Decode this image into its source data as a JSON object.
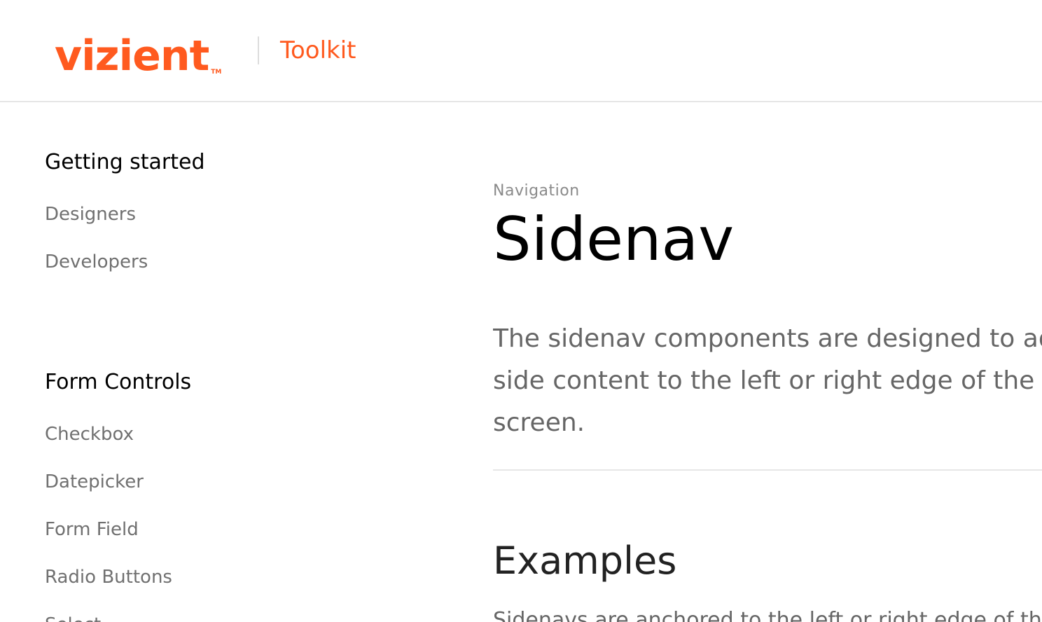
{
  "brand": {
    "logo_text": "vizient",
    "logo_tm": "TM",
    "product_label": "Toolkit",
    "accent_color": "#ff5a1f"
  },
  "sidebar": {
    "sections": [
      {
        "title": "Getting started",
        "items": [
          {
            "label": "Designers"
          },
          {
            "label": "Developers"
          }
        ]
      },
      {
        "title": "Form Controls",
        "items": [
          {
            "label": "Checkbox"
          },
          {
            "label": "Datepicker"
          },
          {
            "label": "Form Field"
          },
          {
            "label": "Radio Buttons"
          },
          {
            "label": "Select"
          }
        ]
      }
    ]
  },
  "main": {
    "eyebrow": "Navigation",
    "title": "Sidenav",
    "lead": "The sidenav components are designed to add side content to the left or right edge of the screen.",
    "examples_title": "Examples",
    "examples_text": "Sidenavs are anchored to the left or right edge of the screen"
  }
}
